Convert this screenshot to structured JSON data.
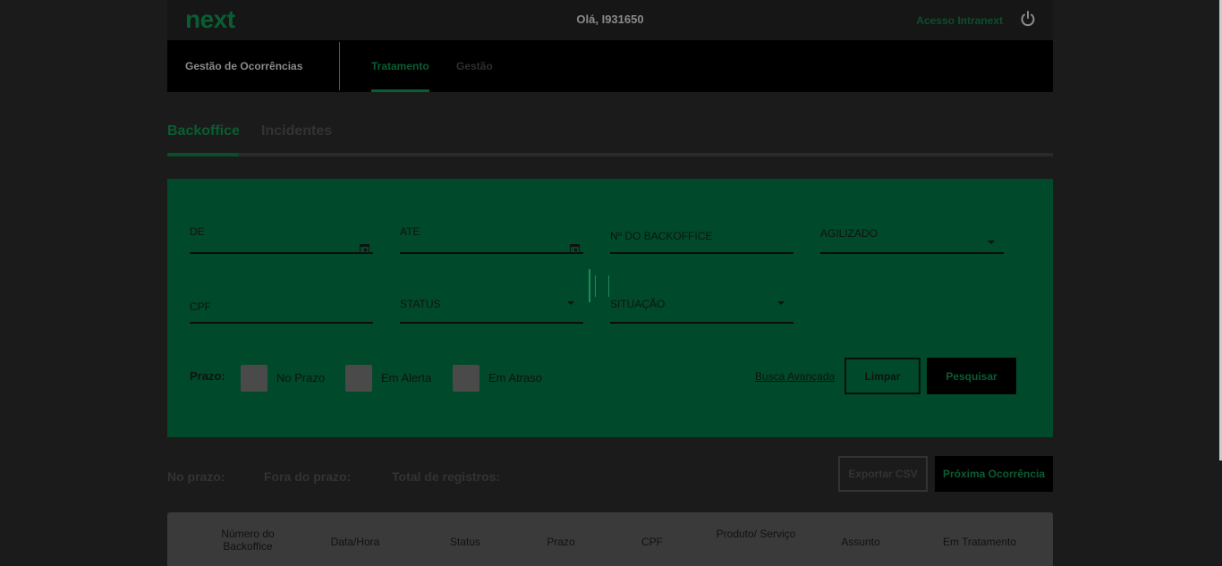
{
  "header": {
    "logo": "next",
    "greeting": "Olá, I931650",
    "intranext_link": "Acesso Intranext",
    "power_icon": "power-icon"
  },
  "nav": {
    "section_title": "Gestão de Ocorrências",
    "tabs": [
      {
        "label": "Tratamento",
        "active": true
      },
      {
        "label": "Gestão",
        "active": false
      }
    ]
  },
  "subtabs": [
    {
      "label": "Backoffice",
      "active": true
    },
    {
      "label": "Incidentes",
      "active": false
    }
  ],
  "filters": {
    "de": {
      "label": "DE",
      "icon": "calendar-icon"
    },
    "ate": {
      "label": "ATE",
      "icon": "calendar-icon"
    },
    "backoffice": {
      "label": "Nº DO BACKOFFICE"
    },
    "agilizado": {
      "label": "AGILIZADO",
      "icon": "chevron-down-icon"
    },
    "cpf": {
      "label": "CPF"
    },
    "status": {
      "label": "STATUS",
      "icon": "chevron-down-icon"
    },
    "situacao": {
      "label": "SITUAÇÃO",
      "icon": "chevron-down-icon"
    },
    "prazo_label": "Prazo:",
    "prazo_options": [
      "No Prazo",
      "Em Alerta",
      "Em Atraso"
    ],
    "busca_avancada": "Busca Avançada",
    "limpar": "Limpar",
    "pesquisar": "Pesquisar"
  },
  "summary": {
    "no_prazo": "No prazo:",
    "fora_prazo": "Fora do prazo:",
    "total": "Total de registros:",
    "exportar": "Exportar CSV",
    "proxima": "Próxima Ocorrência"
  },
  "table": {
    "columns": [
      "Número do Backoffice",
      "Data/Hora",
      "Status",
      "Prazo",
      "CPF",
      "Produto/ Serviço",
      "Assunto",
      "Em Tratamento"
    ]
  },
  "colors": {
    "background": "#1b1b1b",
    "accent": "#0a5d33",
    "panel": "#004a2b"
  }
}
